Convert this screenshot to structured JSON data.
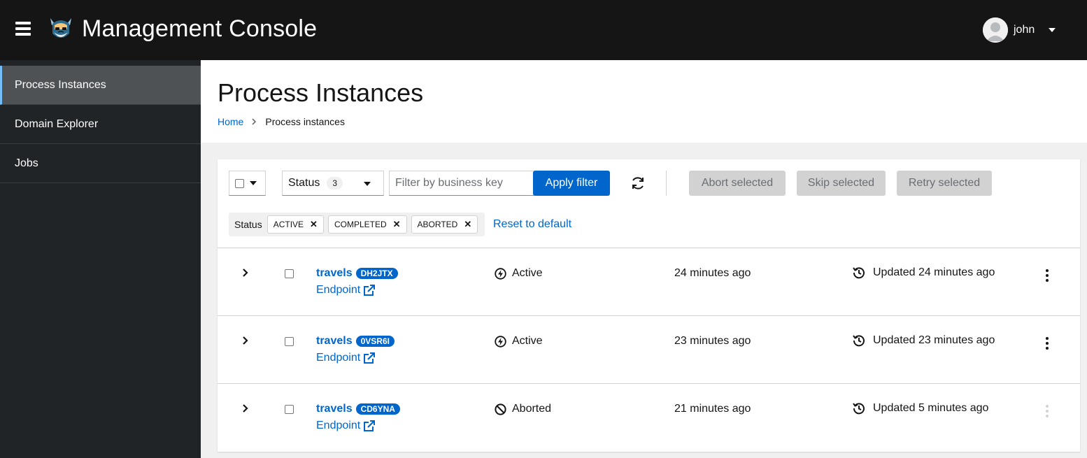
{
  "header": {
    "app_title": "Management Console",
    "user_name": "john"
  },
  "sidebar": {
    "items": [
      {
        "label": "Process Instances",
        "active": true
      },
      {
        "label": "Domain Explorer",
        "active": false
      },
      {
        "label": "Jobs",
        "active": false
      }
    ]
  },
  "page": {
    "title": "Process Instances",
    "breadcrumb": {
      "home": "Home",
      "current": "Process instances"
    }
  },
  "toolbar": {
    "status_label": "Status",
    "status_count": "3",
    "search_placeholder": "Filter by business key",
    "apply_label": "Apply filter",
    "abort_label": "Abort selected",
    "skip_label": "Skip selected",
    "retry_label": "Retry selected"
  },
  "filters": {
    "category": "Status",
    "chips": [
      "ACTIVE",
      "COMPLETED",
      "ABORTED"
    ],
    "reset_label": "Reset to default"
  },
  "rows": [
    {
      "name": "travels",
      "id": "DH2JTX",
      "endpoint": "Endpoint",
      "status": "Active",
      "status_icon": "bolt-icon",
      "created": "24 minutes ago",
      "updated": "Updated 24 minutes ago",
      "kebab_enabled": true
    },
    {
      "name": "travels",
      "id": "0VSR6I",
      "endpoint": "Endpoint",
      "status": "Active",
      "status_icon": "bolt-icon",
      "created": "23 minutes ago",
      "updated": "Updated 23 minutes ago",
      "kebab_enabled": true
    },
    {
      "name": "travels",
      "id": "CD6YNA",
      "endpoint": "Endpoint",
      "status": "Aborted",
      "status_icon": "ban-icon",
      "created": "21 minutes ago",
      "updated": "Updated 5 minutes ago",
      "kebab_enabled": false
    }
  ],
  "colors": {
    "masthead": "#151515",
    "sidebar": "#212427",
    "link": "#0066cc",
    "active_nav": "#4f5255",
    "active_nav_border": "#73bcf7",
    "disabled_button": "#d2d2d2"
  }
}
